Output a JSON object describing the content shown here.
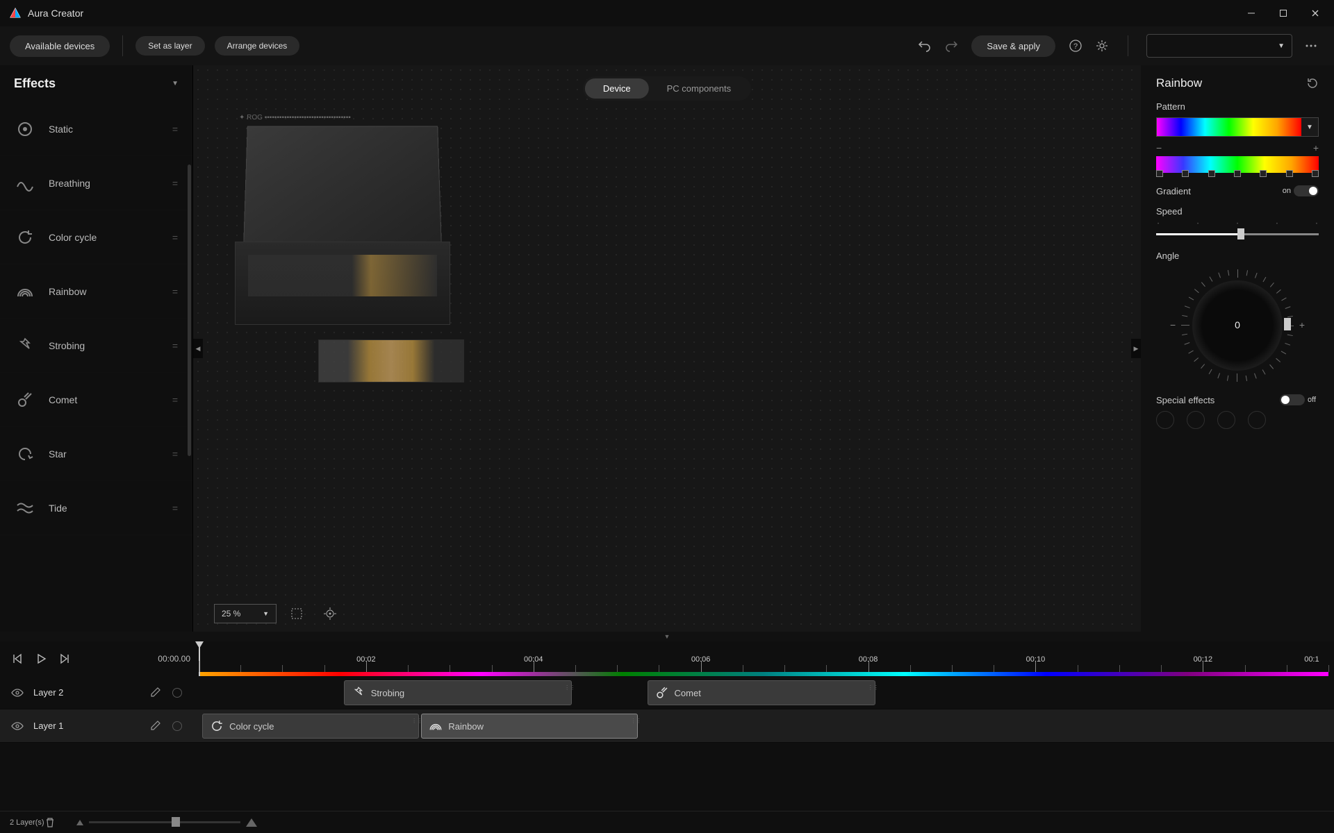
{
  "app": {
    "title": "Aura Creator"
  },
  "toolbar": {
    "available_devices": "Available devices",
    "set_as_layer": "Set as layer",
    "arrange_devices": "Arrange devices",
    "save_apply": "Save & apply"
  },
  "canvas": {
    "tab_device": "Device",
    "tab_pc": "PC components",
    "active_tab": "device",
    "zoom": "25 %"
  },
  "effects": {
    "header": "Effects",
    "items": [
      {
        "id": "static",
        "label": "Static"
      },
      {
        "id": "breathing",
        "label": "Breathing"
      },
      {
        "id": "colorcycle",
        "label": "Color cycle"
      },
      {
        "id": "rainbow",
        "label": "Rainbow"
      },
      {
        "id": "strobing",
        "label": "Strobing"
      },
      {
        "id": "comet",
        "label": "Comet"
      },
      {
        "id": "star",
        "label": "Star"
      },
      {
        "id": "tide",
        "label": "Tide"
      }
    ]
  },
  "properties": {
    "title": "Rainbow",
    "pattern_label": "Pattern",
    "gradient_label": "Gradient",
    "gradient_on": "on",
    "speed_label": "Speed",
    "angle_label": "Angle",
    "angle_value": "0",
    "special_label": "Special effects",
    "special_off": "off"
  },
  "timeline": {
    "time": "00:00.00",
    "ruler_labels": [
      "00:02",
      "00:04",
      "00:06",
      "00:08",
      "00:10",
      "00:12",
      "00:1"
    ],
    "layers": [
      {
        "name": "Layer 2",
        "active": false,
        "clips": [
          {
            "effect": "Strobing",
            "left_pct": 13.2,
            "width_pct": 20.0
          },
          {
            "effect": "Comet",
            "left_pct": 39.8,
            "width_pct": 20.0
          }
        ]
      },
      {
        "name": "Layer 1",
        "active": true,
        "clips": [
          {
            "effect": "Color cycle",
            "left_pct": 0.8,
            "width_pct": 19.0
          },
          {
            "effect": "Rainbow",
            "left_pct": 20.0,
            "width_pct": 19.0,
            "selected": true
          }
        ]
      }
    ],
    "layer_count_label": "2  Layer(s)"
  }
}
